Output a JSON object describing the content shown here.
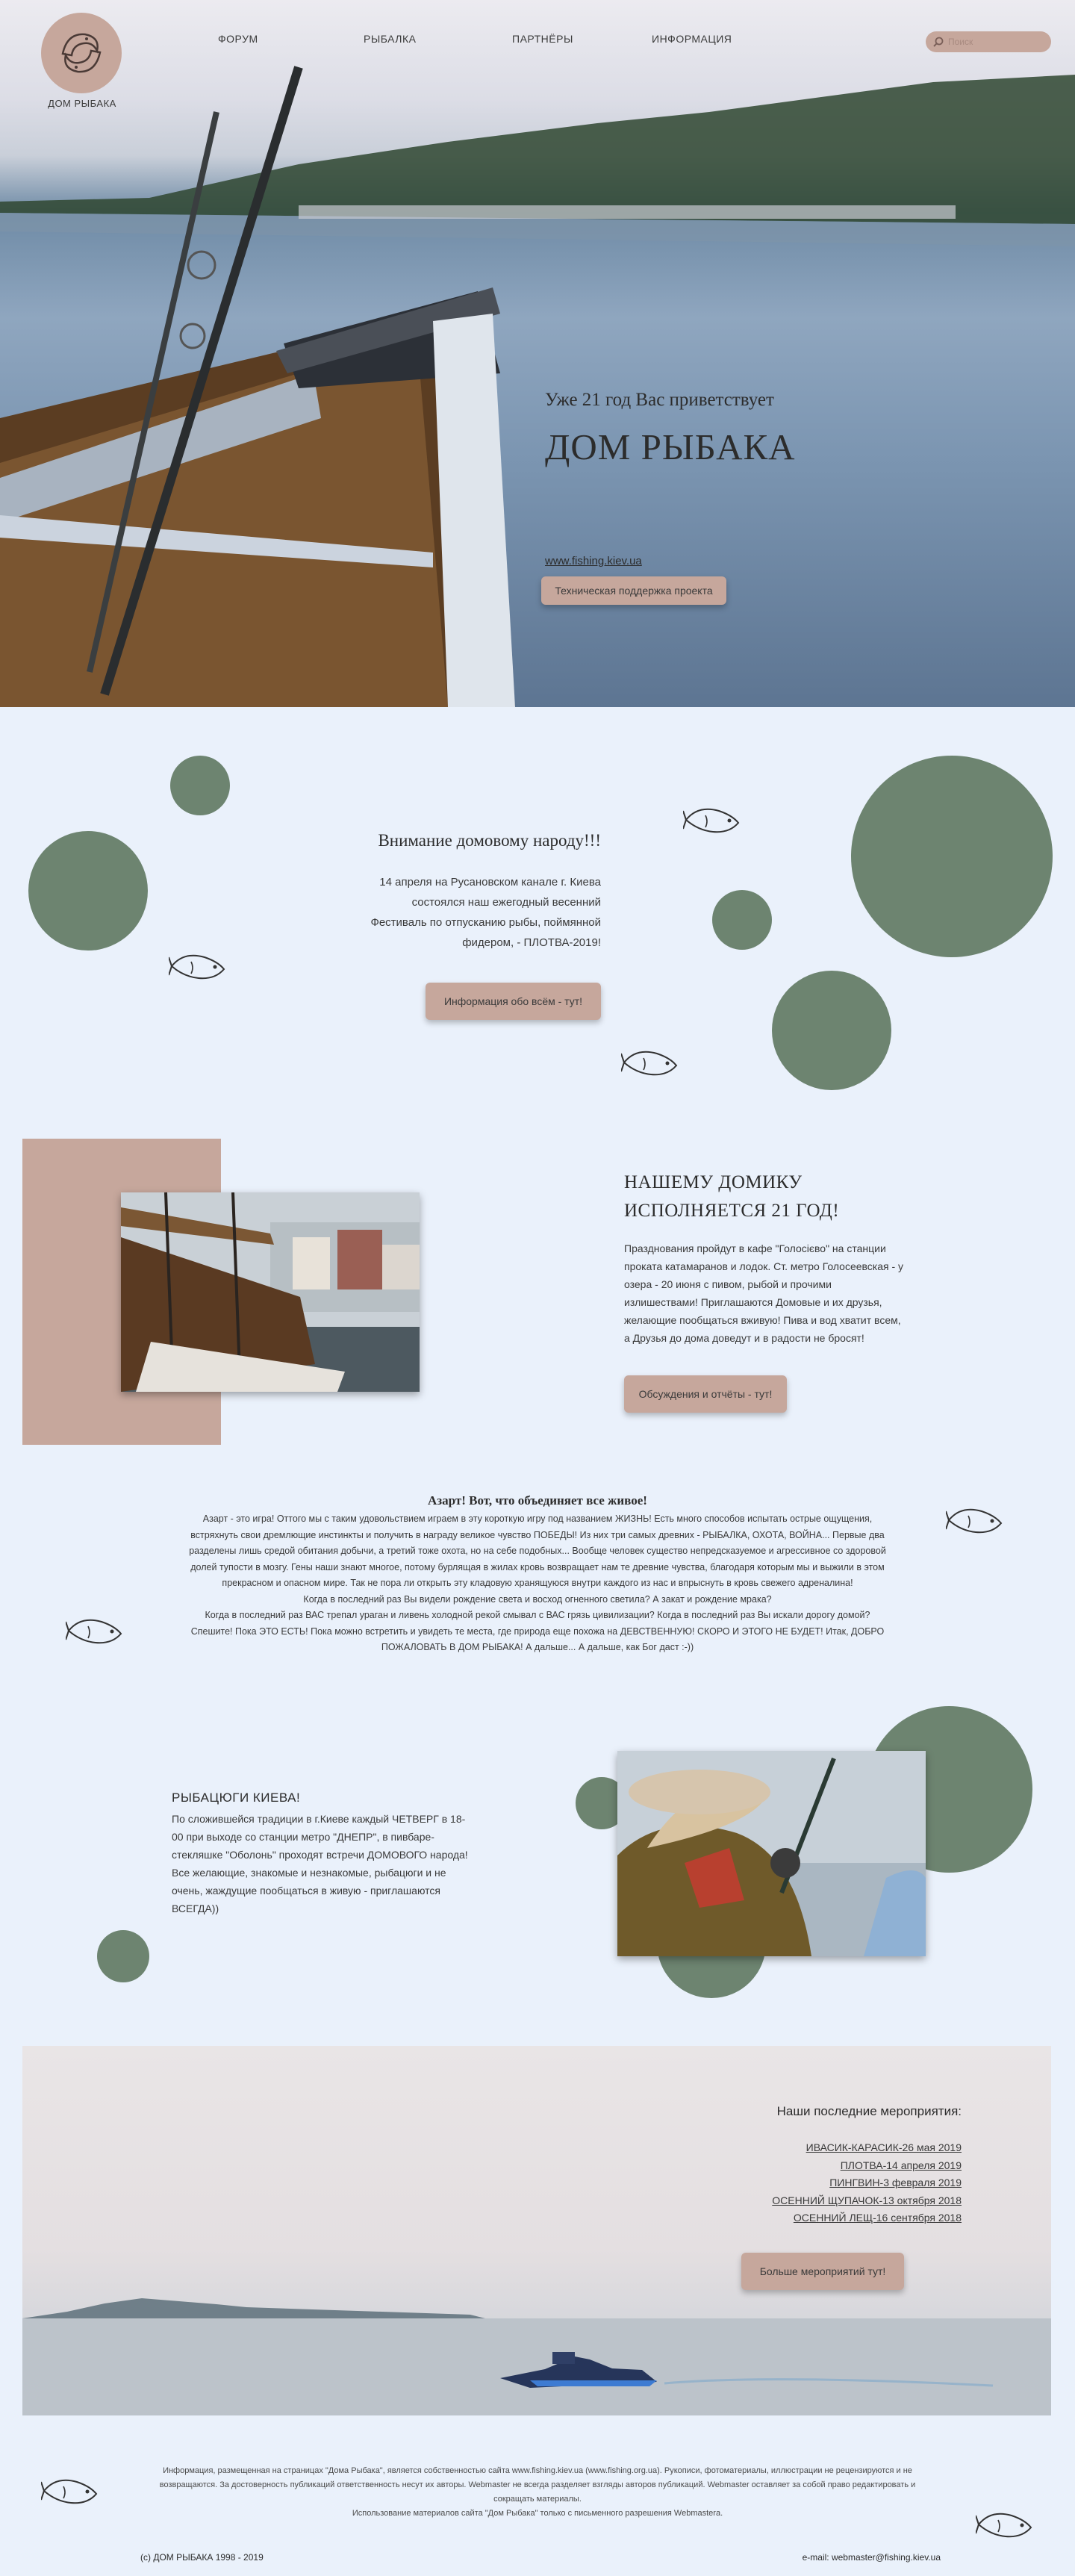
{
  "header": {
    "logo_text": "ДОМ РЫБАКА",
    "nav": [
      "ФОРУМ",
      "РЫБАЛКА",
      "ПАРТНЁРЫ",
      "ИНФОРМАЦИЯ"
    ],
    "search_placeholder": "Поиск"
  },
  "hero": {
    "subtitle": "Уже 21 год Вас приветствует",
    "title": "ДОМ РЫБАКА",
    "link": "www.fishing.kiev.ua",
    "button": "Техническая поддержка проекта"
  },
  "festival": {
    "title": "Внимание домовому народу!!!",
    "lines": [
      "14 апреля на Русановском канале г. Киева",
      "состоялся наш ежегодный весенний",
      "Фестиваль по отпусканию рыбы, поймянной",
      "фидером, - ПЛОТВА-2019!"
    ],
    "button": "Информация обо всём - тут!"
  },
  "anniversary": {
    "title_lines": [
      "НАШЕМУ ДОМИКУ",
      "ИСПОЛНЯЕТСЯ 21 ГОД!"
    ],
    "text": "Празднования пройдут в кафе \"Голосієво\" на станции проката катамаранов и лодок. Ст. метро Голосеевская - у озера - 20 июня с пивом, рыбой и прочими излишествами! Приглашаются Домовые и их друзья, желающие пообщаться вживую! Пива и вод хватит всем, а Друзья до дома доведут и в радости не бросят!",
    "button": "Обсуждения и  отчёты - тут!"
  },
  "passion": {
    "title": "Азарт! Вот, что объединяет все живое!",
    "lines": [
      "Азарт - это игра! Оттого мы с таким удовольствием играем в эту короткую игру под названием ЖИЗНЬ! Есть много способов испытать острые ощущения,",
      "встряхнуть свои дремлющие инстинкты и получить в награду великое чувство ПОБЕДЫ! Из них три самых древних - РЫБАЛКА, ОХОТА, ВОЙНА... Первые два",
      "разделены лишь средой обитания добычи, а третий тоже охота, но на себе подобных... Вообще человек существо непредсказуемое и агрессивное со здоровой",
      "долей тупости в мозгу. Гены наши знают многое, потому бурлящая в жилах кровь возвращает нам те древние чувства, благодаря которым мы и выжили в этом",
      "прекрасном и опасном мире. Так не пора ли открыть эту кладовую хранящуюся внутри каждого из нас и впрыснуть в кровь свежего адреналина!",
      "Когда в последний раз Вы видели рождение света и восход огненного светила? А закат и рождение мрака?",
      "Когда в последний раз ВАС трепал ураган и ливень холодной рекой смывал с ВАС грязь цивилизации? Когда в последний раз Вы искали дорогу домой?",
      "Спешите! Пока ЭТО ЕСТЬ! Пока можно встретить и увидеть те места, где природа еще похожа на ДЕВСТВЕННУЮ! СКОРО И ЭТОГО НЕ БУДЕТ! Итак, ДОБРО",
      "ПОЖАЛОВАТЬ В ДОМ РЫБАКА! А дальше... А дальше, как Бог даст :-))"
    ]
  },
  "meetings": {
    "title": "РЫБАЦЮГИ КИЕВА!",
    "text": "По сложившейся традиции в г.Киеве каждый ЧЕТВЕРГ в 18-00 при выходе со станции метро \"ДНЕПР\", в пивбаре-стекляшке \"Оболонь\" проходят встречи ДОМОВОГО народа! Все желающие, знакомые и незнакомые, рыбацюги и не очень, жаждущие пообщаться в живую - приглашаются ВСЕГДА))"
  },
  "events": {
    "title": "Наши последние мероприятия:",
    "items": [
      "ИВАСИК-КАРАСИК-26 мая 2019",
      "ПЛОТВА-14 апреля 2019",
      "ПИНГВИН-3 февраля 2019",
      "ОСЕННИЙ ЩУПАЧОК-13 октября 2018",
      "ОСЕННИЙ ЛЕЩ-16 сентября 2018"
    ],
    "button": "Больше мероприятий тут!"
  },
  "footer": {
    "lines": [
      "Информация, размещенная на страницах \"Дома Рыбака\", является собственностью сайта www.fishing.kiev.ua (www.fishing.org.ua). Рукописи, фотоматериалы, иллюстрации не рецензируются и не",
      "возвращаются. За достоверность публикаций ответственность несут их авторы. Webmaster не всегда разделяет взгляды авторов публикаций. Webmaster оставляет за собой право редактировать и",
      "сокращать материалы.",
      "Использование материалов сайта \"Дом Рыбака\" только с письменного разрешения Webmastera."
    ],
    "copyright": "(c) ДОМ РЫБАКА  1998 - 2019",
    "email": "e-mail: webmaster@fishing.kiev.ua"
  },
  "colors": {
    "accent": "#c6a79c",
    "circle": "#6d8470",
    "background": "#eaf1fb"
  },
  "icons": [
    "fish-logo-icon",
    "search-icon",
    "fish-icon"
  ]
}
